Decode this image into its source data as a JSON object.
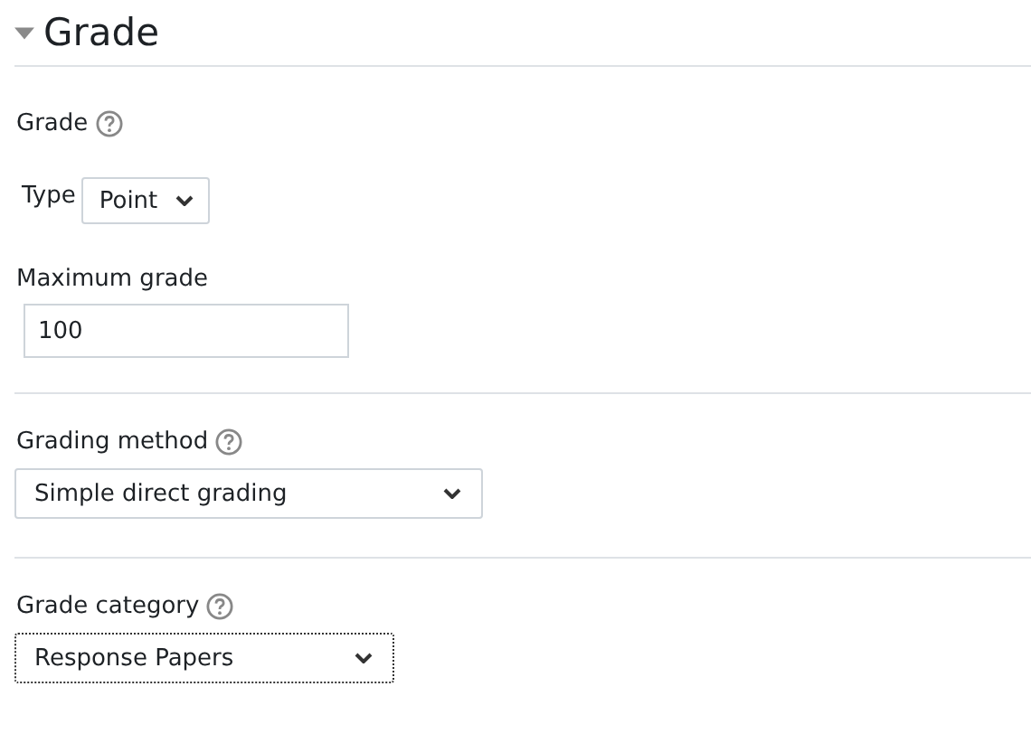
{
  "section": {
    "title": "Grade",
    "expanded": true
  },
  "grade_group": {
    "label": "Grade",
    "help": true,
    "type_label": "Type",
    "type_value": "Point"
  },
  "maximum_grade": {
    "label": "Maximum grade",
    "value": "100"
  },
  "fields": [
    {
      "label": "Grading method",
      "help": true,
      "value": "Simple direct grading",
      "focused": false,
      "wide": true
    },
    {
      "label": "Grade category",
      "help": true,
      "value": "Response Papers",
      "focused": true,
      "wide": false
    }
  ]
}
